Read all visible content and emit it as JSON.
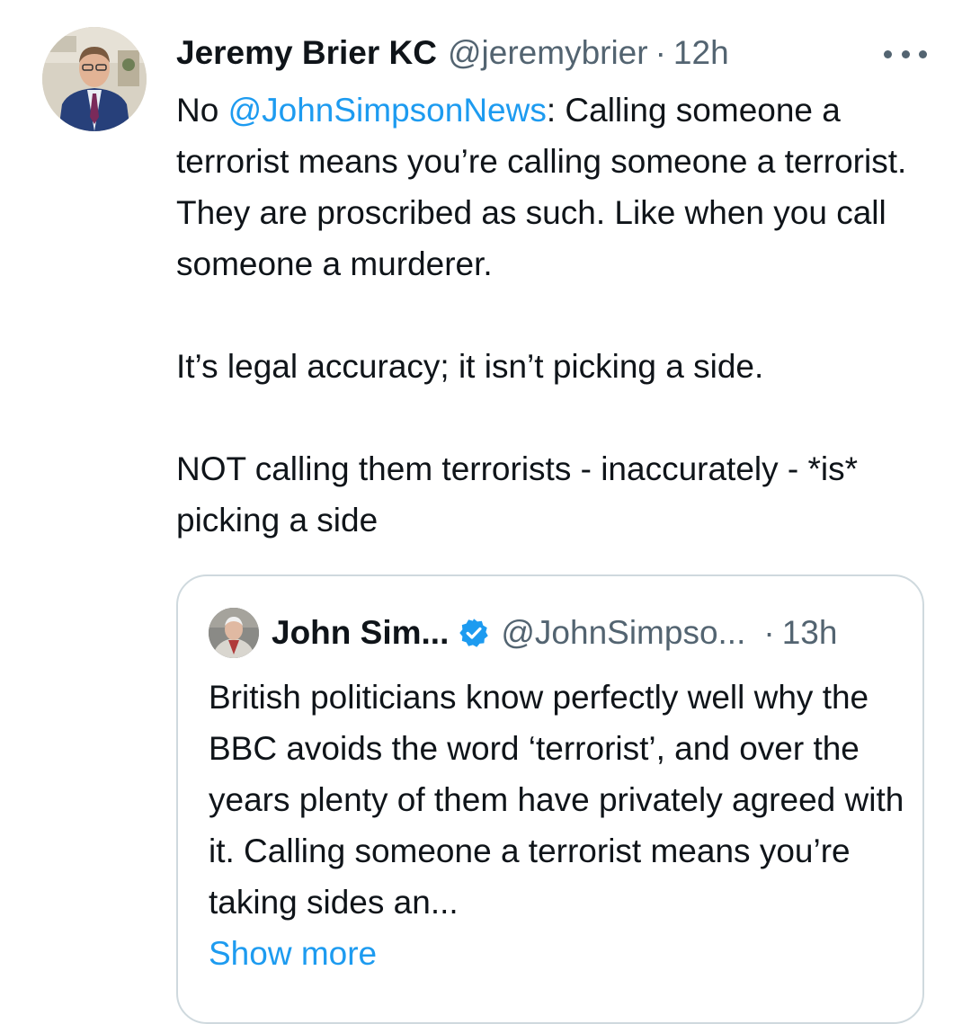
{
  "tweet": {
    "author_name": "Jeremy Brier KC",
    "author_handle": "@jeremybrier",
    "separator": "·",
    "time": "12h",
    "more_icon": "more-horizontal-icon",
    "text": {
      "p1_prefix": "No ",
      "p1_mention": "@JohnSimpsonNews",
      "p1_suffix": ": Calling someone a terrorist means you’re calling someone a terrorist. They are proscribed as such. Like when you call someone a murderer.",
      "p2": "It’s legal accuracy; it isn’t picking a side.",
      "p3": "NOT calling them terrorists - inaccurately - *is* picking a side"
    }
  },
  "quote": {
    "author_name": "John Sim...",
    "verified_icon": "verified-badge-icon",
    "author_handle": "@JohnSimpso...",
    "separator": "·",
    "time": "13h",
    "text": "British politicians know perfectly well why the BBC avoids the word ‘terrorist’, and over the years plenty of them have privately agreed with it.  Calling someone a terrorist means you’re taking sides an...",
    "show_more": "Show more"
  },
  "colors": {
    "link": "#1d9bf0",
    "secondary_text": "#536471",
    "border": "#cfd9de",
    "primary_text": "#0f1419"
  }
}
